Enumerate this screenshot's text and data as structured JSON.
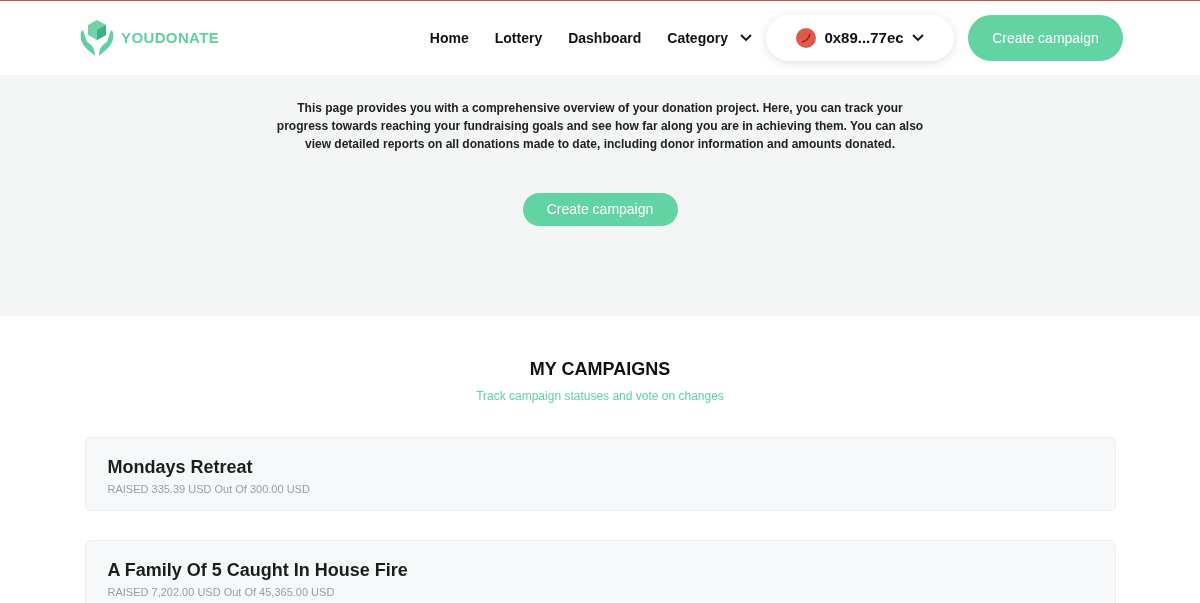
{
  "brand": "YOUDONATE",
  "nav": [
    {
      "label": "Home",
      "kind": "link"
    },
    {
      "label": "Lottery",
      "kind": "link"
    },
    {
      "label": "Dashboard",
      "kind": "link"
    },
    {
      "label": "Category",
      "kind": "dropdown"
    }
  ],
  "wallet": {
    "address": "0x89...77ec"
  },
  "header_button": "Create campaign",
  "hero": {
    "text": "This page provides you with a comprehensive overview of your donation project. Here, you can track your progress towards reaching your fundraising goals and see how far along you are in achieving them. You can also view detailed reports on all donations made to date, including donor information and amounts donated.",
    "button": "Create campaign"
  },
  "campaigns_section": {
    "title": "MY CAMPAIGNS",
    "subtitle": "Track campaign statuses and vote on changes",
    "campaigns": [
      {
        "title": "Mondays Retreat",
        "raised": "RAISED 335.39 USD Out Of 300.00 USD"
      },
      {
        "title": "A Family Of 5 Caught In House Fire",
        "raised": "RAISED 7,202.00 USD Out Of 45,365.00 USD"
      }
    ]
  }
}
